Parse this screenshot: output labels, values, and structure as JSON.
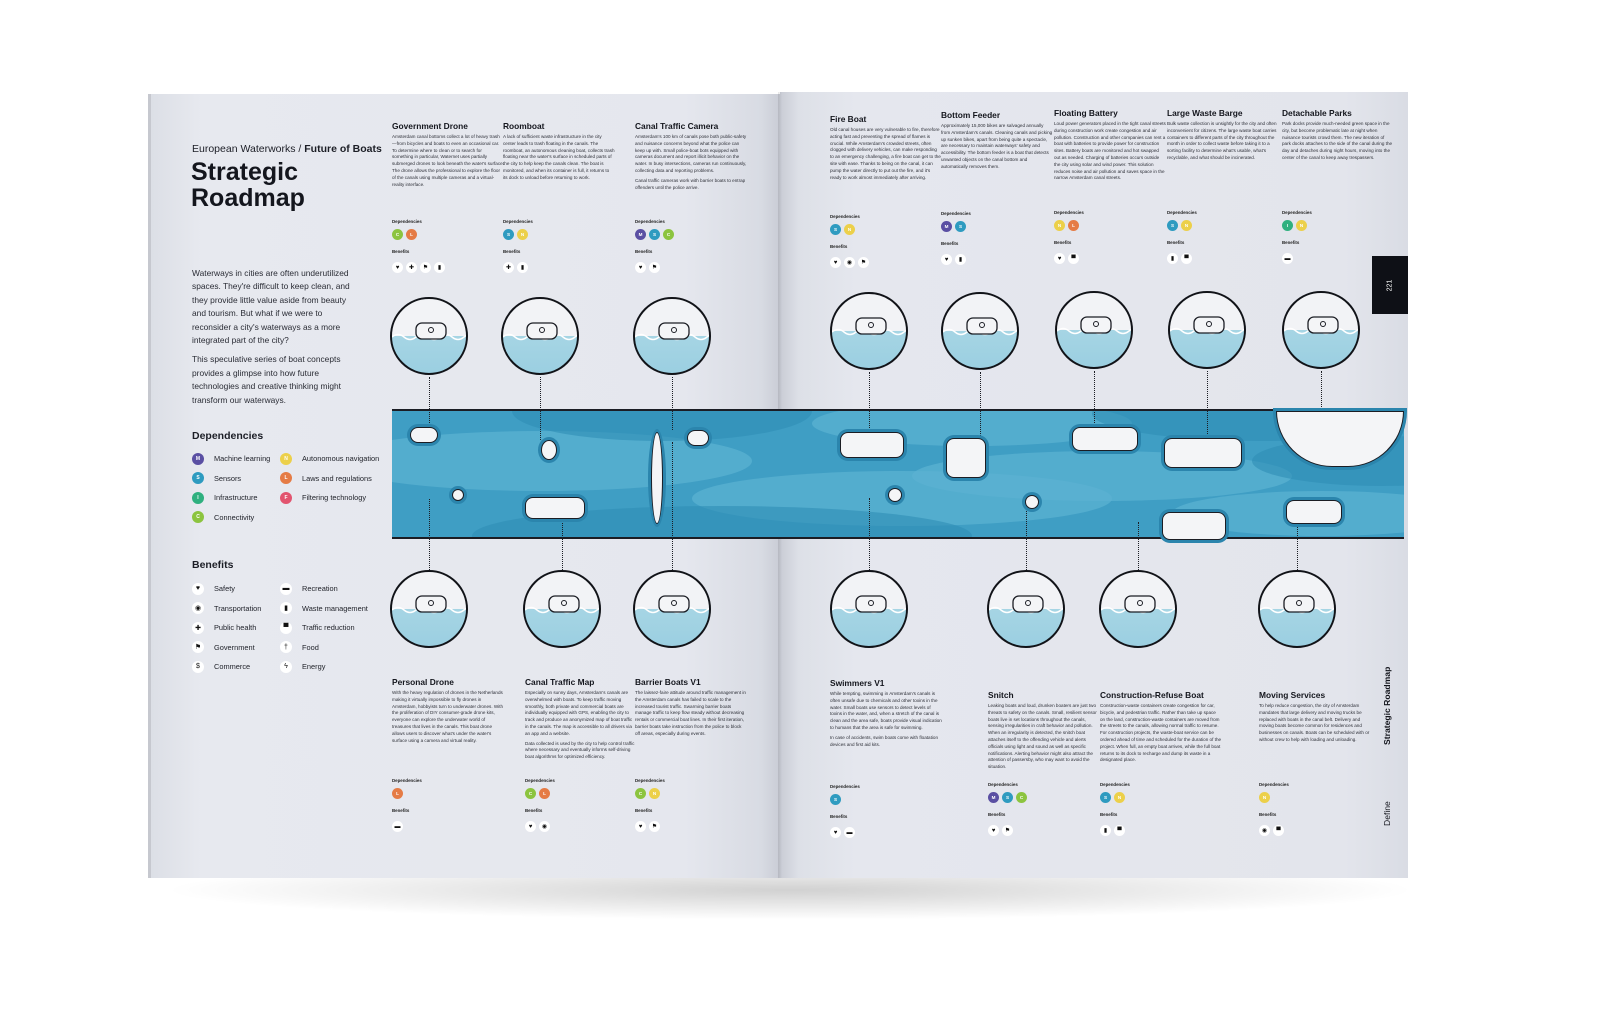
{
  "header": {
    "kicker_regular": "European Waterworks /",
    "kicker_bold": "Future of Boats",
    "title_line1": "Strategic",
    "title_line2": "Roadmap"
  },
  "intro": [
    "Waterways in cities are often underutilized spaces. They're difficult to keep clean, and they provide little value aside from beauty and tourism. But what if we were to reconsider a city's waterways as a more integrated part of the city?",
    "This speculative series of boat concepts provides a glimpse into how future technologies and creative thinking might transform our waterways."
  ],
  "legend": {
    "dependencies_heading": "Dependencies",
    "dependencies": [
      {
        "code": "M",
        "label": "Machine learning",
        "color": "#5a4fa3"
      },
      {
        "code": "S",
        "label": "Sensors",
        "color": "#2e9bc0"
      },
      {
        "code": "I",
        "label": "Infrastructure",
        "color": "#2fb07f"
      },
      {
        "code": "C",
        "label": "Connectivity",
        "color": "#8cc43f"
      },
      {
        "code": "N",
        "label": "Autonomous navigation",
        "color": "#ecd04a"
      },
      {
        "code": "L",
        "label": "Laws and regulations",
        "color": "#e57b45"
      },
      {
        "code": "F",
        "label": "Filtering technology",
        "color": "#e2546f"
      }
    ],
    "benefits_heading": "Benefits",
    "benefits": [
      {
        "icon": "heart-icon",
        "glyph": "♥",
        "label": "Safety"
      },
      {
        "icon": "location-pin-icon",
        "glyph": "◉",
        "label": "Transportation"
      },
      {
        "icon": "plus-icon",
        "glyph": "✚",
        "label": "Public health"
      },
      {
        "icon": "flag-icon",
        "glyph": "⚑",
        "label": "Government"
      },
      {
        "icon": "dollar-icon",
        "glyph": "$",
        "label": "Commerce"
      },
      {
        "icon": "sunglasses-icon",
        "glyph": "▬",
        "label": "Recreation"
      },
      {
        "icon": "trash-icon",
        "glyph": "▮",
        "label": "Waste management"
      },
      {
        "icon": "car-icon",
        "glyph": "▀",
        "label": "Traffic reduction"
      },
      {
        "icon": "fork-knife-icon",
        "glyph": "†",
        "label": "Food"
      },
      {
        "icon": "lightning-icon",
        "glyph": "ϟ",
        "label": "Energy"
      }
    ]
  },
  "labels": {
    "dependencies": "Dependencies",
    "benefits": "Benefits"
  },
  "concepts_top": [
    {
      "title": "Government Drone",
      "paragraphs": [
        "Amsterdam canal bottoms collect a lot of heavy trash—from bicycles and boats to even an occasional car. To determine where to clean or to search for something in particular, Waternet uses partially submerged drones to look beneath the water's surface. The drone allows the professional to explore the floor of the canals using multiple cameras and a virtual-reality interface."
      ],
      "deps": [
        "C",
        "L"
      ],
      "benefits": [
        "heart-icon",
        "plus-icon",
        "flag-icon",
        "trash-icon"
      ]
    },
    {
      "title": "Roomboat",
      "paragraphs": [
        "A lack of sufficient waste infrastructure in the city center leads to trash floating in the canals. The roomboat, an autonomous cleaning boat, collects trash floating near the water's surface in scheduled parts of the city to help keep the canals clean. The boat is monitored, and when its container is full, it returns to its dock to unload before returning to work."
      ],
      "deps": [
        "S",
        "N"
      ],
      "benefits": [
        "plus-icon",
        "trash-icon"
      ]
    },
    {
      "title": "Canal Traffic Camera",
      "paragraphs": [
        "Amsterdam's 100 km of canals pose both public-safety and nuisance concerns beyond what the police can keep up with. Small police-boat bots equipped with cameras document and report illicit behavior on the water. In busy intersections, cameras run continuously, collecting data and reporting problems.",
        "Canal traffic cameras work with barrier boats to entrap offenders until the police arrive."
      ],
      "deps": [
        "M",
        "S",
        "C"
      ],
      "benefits": [
        "heart-icon",
        "flag-icon"
      ]
    },
    {
      "title": "Fire Boat",
      "paragraphs": [
        "Old canal houses are very vulnerable to fire, therefore acting fast and preventing the spread of flames is crucial. While Amsterdam's crowded streets, often clogged with delivery vehicles, can make responding to an emergency challenging, a fire boat can get to the site with ease. Thanks to being on the canal, it can pump the water directly to put out the fire, and it's ready to work almost immediately after arriving."
      ],
      "deps": [
        "S",
        "N"
      ],
      "benefits": [
        "heart-icon",
        "location-pin-icon",
        "flag-icon"
      ]
    },
    {
      "title": "Bottom Feeder",
      "paragraphs": [
        "Approximately 15,000 bikes are salvaged annually from Amsterdam's canals. Cleaning canals and picking up sunken bikes, apart from being quite a spectacle, are necessary to maintain waterways' safety and accessibility. The bottom feeder is a boat that detects unwanted objects on the canal bottom and automatically removes them."
      ],
      "deps": [
        "M",
        "S"
      ],
      "benefits": [
        "heart-icon",
        "trash-icon"
      ]
    },
    {
      "title": "Floating Battery",
      "paragraphs": [
        "Loud power generators placed in the tight canal streets during construction work create congestion and air pollution. Construction and other companies can rent a boat with batteries to provide power for construction sites. Battery boats are monitored and hot swapped out as needed. Charging of batteries occurs outside the city using solar and wind power. This solution reduces noise and air pollution and saves space in the narrow Amsterdam canal streets."
      ],
      "deps": [
        "N",
        "L"
      ],
      "benefits": [
        "heart-icon",
        "car-icon"
      ]
    },
    {
      "title": "Large Waste Barge",
      "paragraphs": [
        "Bulk waste collection is unsightly for the city and often inconvenient for citizens. The large waste boat carries containers to different parts of the city throughout the month in order to collect waste before taking it to a sorting facility to determine what's usable, what's recyclable, and what should be incinerated."
      ],
      "deps": [
        "S",
        "N"
      ],
      "benefits": [
        "trash-icon",
        "car-icon"
      ]
    },
    {
      "title": "Detachable Parks",
      "paragraphs": [
        "Park docks provide much-needed green space in the city, but become problematic late at night when nuisance tourists crowd them. The new iteration of park docks attaches to the side of the canal during the day and detaches during night hours, moving into the center of the canal to keep away trespassers."
      ],
      "deps": [
        "I",
        "N"
      ],
      "benefits": [
        "sunglasses-icon"
      ]
    }
  ],
  "concepts_bottom": [
    {
      "title": "Personal Drone",
      "paragraphs": [
        "With the heavy regulation of drones in the Netherlands making it virtually impossible to fly drones in Amsterdam, hobbyists turn to underwater drones. With the proliferation of DIY consumer-grade drone kits, everyone can explore the underwater world of treasures that lives in the canals. This boat drone allows users to discover what's under the water's surface using a camera and virtual reality."
      ],
      "deps": [
        "L"
      ],
      "benefits": [
        "sunglasses-icon"
      ]
    },
    {
      "title": "Canal Traffic Map",
      "paragraphs": [
        "Especially on sunny days, Amsterdam's canals are overwhelmed with boats. To keep traffic moving smoothly, both private and commercial boats are individually equipped with GPS, enabling the city to track and produce an anonymized map of boat traffic in the canals. The map is accessible to all drivers via an app and a website.",
        "Data collected is used by the city to help control traffic where necessary and eventually informs self-driving boat algorithms for optimized efficiency."
      ],
      "deps": [
        "C",
        "L"
      ],
      "benefits": [
        "heart-icon",
        "location-pin-icon"
      ]
    },
    {
      "title": "Barrier Boats V1",
      "paragraphs": [
        "The laissez-faire attitude around traffic management in the Amsterdam canals has failed to scale to the increased tourist traffic. Swarming barrier boats manage traffic to keep flow steady without decreasing rentals or commercial boat lines. In their first iteration, barrier boats take instruction from the police to block off areas, especially during events."
      ],
      "deps": [
        "C",
        "N"
      ],
      "benefits": [
        "heart-icon",
        "flag-icon"
      ]
    },
    {
      "title": "Swimmers V1",
      "paragraphs": [
        "While tempting, swimming in Amsterdam's canals is often unsafe due to chemicals and other toxins in the water. Small boats use sensors to detect levels of toxins in the water, and, when a stretch of the canal is clean and the area safe, boats provide visual indication to humans that the area is safe for swimming.",
        "In case of accidents, swim boats come with floatation devices and first aid kits."
      ],
      "deps": [
        "S"
      ],
      "benefits": [
        "heart-icon",
        "sunglasses-icon"
      ]
    },
    {
      "title": "Snitch",
      "paragraphs": [
        "Leaking boats and loud, drunken boaters are just two threats to safety on the canals. Small, resilient sensor boats live in set locations throughout the canals, sensing irregularities in craft behavior and pollution. When an irregularity is detected, the snitch boat attaches itself to the offending vehicle and alerts officials using light and sound as well as specific notifications. Alerting behavior might also attract the attention of passersby, who may want to avoid the situation."
      ],
      "deps": [
        "M",
        "S",
        "C"
      ],
      "benefits": [
        "heart-icon",
        "flag-icon"
      ]
    },
    {
      "title": "Construction-Refuse Boat",
      "paragraphs": [
        "Construction-waste containers create congestion for car, bicycle, and pedestrian traffic. Rather than take up space on the land, construction-waste containers are moved from the streets to the canals, allowing normal traffic to resume. For construction projects, the waste-boat service can be ordered ahead of time and scheduled for the duration of the project. When full, an empty boat arrives, while the full boat returns to its dock to recharge and dump its waste in a designated place."
      ],
      "deps": [
        "S",
        "N"
      ],
      "benefits": [
        "trash-icon",
        "car-icon"
      ]
    },
    {
      "title": "Moving Services",
      "paragraphs": [
        "To help reduce congestion, the city of Amsterdam mandates that large delivery and moving trucks be replaced with boats in the canal belt. Delivery and moving boats become common for residences and businesses on canals. Boats can be scheduled with or without crew to help with loading and unloading."
      ],
      "deps": [
        "N"
      ],
      "benefits": [
        "location-pin-icon",
        "car-icon"
      ]
    }
  ],
  "page_tab": {
    "page_number": "221",
    "section_title": "Strategic Roadmap",
    "chapter": "Define"
  }
}
